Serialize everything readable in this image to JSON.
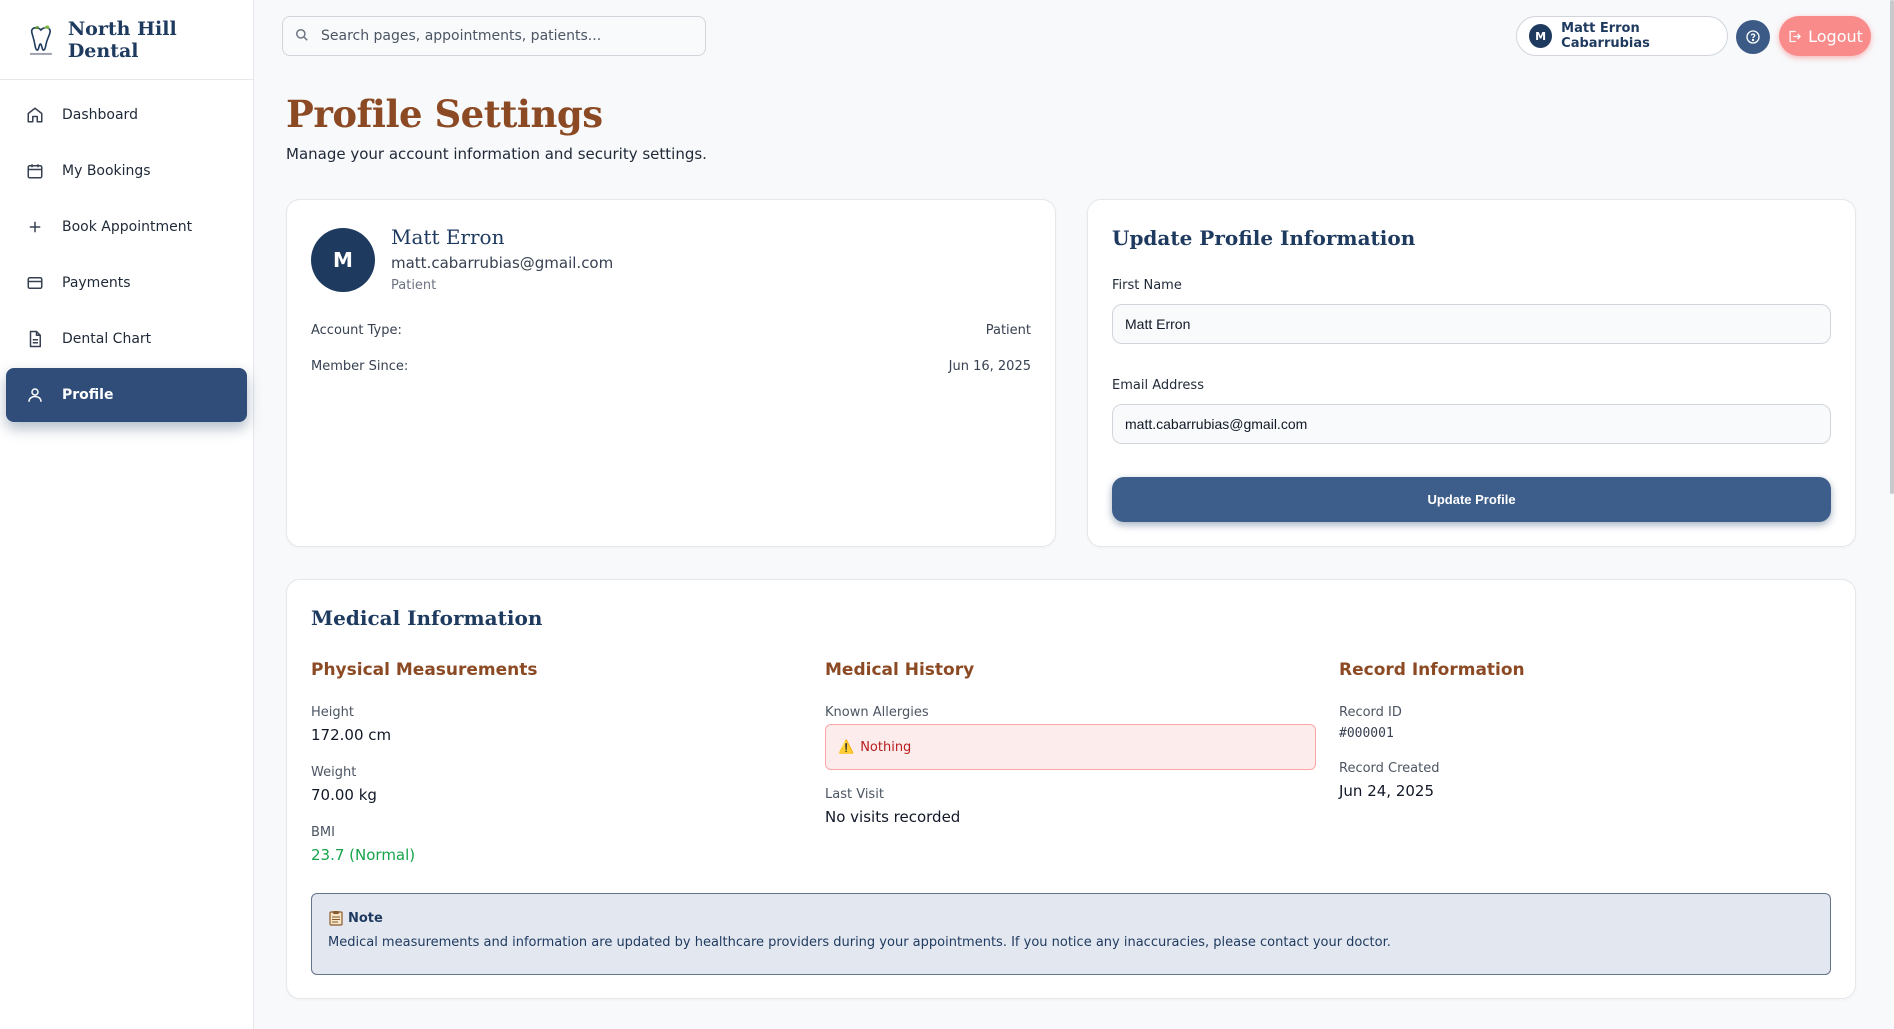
{
  "brand": {
    "name": "North Hill Dental"
  },
  "sidebar": {
    "items": [
      {
        "label": "Dashboard",
        "icon": "home-icon"
      },
      {
        "label": "My Bookings",
        "icon": "calendar-icon"
      },
      {
        "label": "Book Appointment",
        "icon": "plus-icon"
      },
      {
        "label": "Payments",
        "icon": "credit-card-icon"
      },
      {
        "label": "Dental Chart",
        "icon": "document-icon"
      },
      {
        "label": "Profile",
        "icon": "user-icon",
        "active": true
      }
    ]
  },
  "header": {
    "search_placeholder": "Search pages, appointments, patients...",
    "user_initial": "M",
    "user_name": "Matt Erron Cabarrubias",
    "logout_label": "Logout"
  },
  "page": {
    "title": "Profile Settings",
    "subtitle": "Manage your account information and security settings."
  },
  "profile_card": {
    "initial": "M",
    "name": "Matt Erron",
    "email": "matt.cabarrubias@gmail.com",
    "role": "Patient",
    "account_type_label": "Account Type:",
    "account_type_value": "Patient",
    "member_since_label": "Member Since:",
    "member_since_value": "Jun 16, 2025"
  },
  "update_form": {
    "title": "Update Profile Information",
    "first_name_label": "First Name",
    "first_name_value": "Matt Erron",
    "email_label": "Email Address",
    "email_value": "matt.cabarrubias@gmail.com",
    "submit_label": "Update Profile"
  },
  "medical": {
    "title": "Medical Information",
    "physical": {
      "heading": "Physical Measurements",
      "height_label": "Height",
      "height_value": "172.00 cm",
      "weight_label": "Weight",
      "weight_value": "70.00 kg",
      "bmi_label": "BMI",
      "bmi_value": "23.7 (Normal)"
    },
    "history": {
      "heading": "Medical History",
      "allergies_label": "Known Allergies",
      "allergies_value": "Nothing",
      "last_visit_label": "Last Visit",
      "last_visit_value": "No visits recorded"
    },
    "record": {
      "heading": "Record Information",
      "id_label": "Record ID",
      "id_value": "#000001",
      "created_label": "Record Created",
      "created_value": "Jun 24, 2025"
    },
    "note": {
      "title": "Note",
      "text": "Medical measurements and information are updated by healthcare providers during your appointments. If you notice any inaccuracies, please contact your doctor."
    }
  },
  "colors": {
    "primary": "#1e3a5f",
    "accent": "#8b4a24",
    "active_nav": "#2f4d78",
    "logout": "#f98b8b",
    "bmi_normal": "#16a34a",
    "allergy_bg": "#fdecec"
  }
}
